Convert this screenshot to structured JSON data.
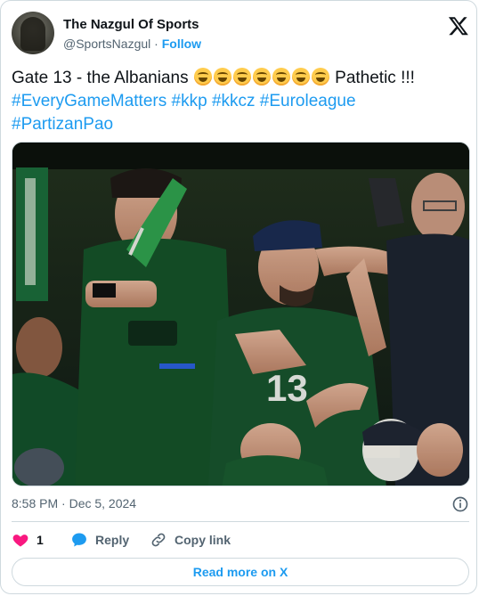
{
  "author": {
    "name": "The Nazgul Of Sports",
    "handle": "@SportsNazgul",
    "separator": "·",
    "follow_label": "Follow"
  },
  "tweet": {
    "text_before": "Gate 13 - the Albanians",
    "emoji_name": "face-with-tears-of-joy",
    "emoji_count": 7,
    "text_after": "Pathetic !!!",
    "hashtags": [
      "#EveryGameMatters",
      "#kkp",
      "#kkcz",
      "#Euroleague",
      "#PartizanPao"
    ]
  },
  "media": {
    "jersey_text": "13"
  },
  "meta": {
    "timestamp": "8:58 PM · Dec 5, 2024"
  },
  "actions": {
    "like_count": "1",
    "reply_label": "Reply",
    "copy_link_label": "Copy link"
  },
  "read_more_label": "Read more on X",
  "colors": {
    "link": "#1d9bf0",
    "like": "#f91880",
    "reply": "#1d9bf0",
    "secondary": "#536471",
    "border": "#cfd9de"
  }
}
